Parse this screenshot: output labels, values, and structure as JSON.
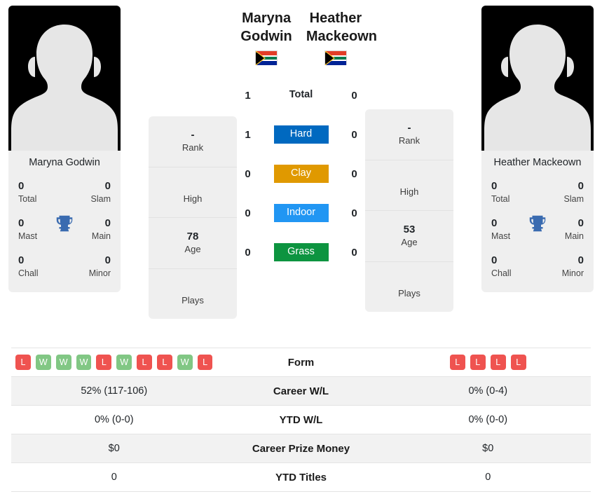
{
  "players": {
    "left": {
      "name": "Maryna Godwin",
      "card_name": "Maryna Godwin",
      "country": "South Africa",
      "flag_icon": "flag-south-africa",
      "photo_icon": "player-photo-placeholder",
      "rank": "-",
      "rank_label": "Rank",
      "high_value": "",
      "high_label": "High",
      "age": "78",
      "age_label": "Age",
      "plays_value": "",
      "plays_label": "Plays",
      "titles": {
        "total_value": "0",
        "total_label": "Total",
        "slam_value": "0",
        "slam_label": "Slam",
        "mast_value": "0",
        "mast_label": "Mast",
        "main_value": "0",
        "main_label": "Main",
        "chall_value": "0",
        "chall_label": "Chall",
        "minor_value": "0",
        "minor_label": "Minor",
        "trophy_icon": "trophy-icon"
      },
      "form": [
        "L",
        "W",
        "W",
        "W",
        "L",
        "W",
        "L",
        "L",
        "W",
        "L"
      ],
      "career_wl": "52% (117-106)",
      "ytd_wl": "0% (0-0)",
      "career_prize_money": "$0",
      "ytd_titles": "0"
    },
    "right": {
      "name": "Heather Mackeown",
      "card_name": "Heather Mackeown",
      "country": "South Africa",
      "flag_icon": "flag-south-africa",
      "photo_icon": "player-photo-placeholder",
      "rank": "-",
      "rank_label": "Rank",
      "high_value": "",
      "high_label": "High",
      "age": "53",
      "age_label": "Age",
      "plays_value": "",
      "plays_label": "Plays",
      "titles": {
        "total_value": "0",
        "total_label": "Total",
        "slam_value": "0",
        "slam_label": "Slam",
        "mast_value": "0",
        "mast_label": "Mast",
        "main_value": "0",
        "main_label": "Main",
        "chall_value": "0",
        "chall_label": "Chall",
        "minor_value": "0",
        "minor_label": "Minor",
        "trophy_icon": "trophy-icon"
      },
      "form": [
        "L",
        "L",
        "L",
        "L"
      ],
      "career_wl": "0% (0-4)",
      "ytd_wl": "0% (0-0)",
      "career_prize_money": "$0",
      "ytd_titles": "0"
    }
  },
  "head_to_head": [
    {
      "label": "Total",
      "left": "1",
      "right": "0",
      "color": ""
    },
    {
      "label": "Hard",
      "left": "1",
      "right": "0",
      "color": "#0069c0"
    },
    {
      "label": "Clay",
      "left": "0",
      "right": "0",
      "color": "#e09900"
    },
    {
      "label": "Indoor",
      "left": "0",
      "right": "0",
      "color": "#2196f3"
    },
    {
      "label": "Grass",
      "left": "0",
      "right": "0",
      "color": "#0d9440"
    }
  ],
  "stats_rows": [
    {
      "label": "Form",
      "left": "",
      "right": ""
    },
    {
      "label": "Career W/L",
      "left": "52% (117-106)",
      "right": "0% (0-4)"
    },
    {
      "label": "YTD W/L",
      "left": "0% (0-0)",
      "right": "0% (0-0)"
    },
    {
      "label": "Career Prize Money",
      "left": "$0",
      "right": "$0"
    },
    {
      "label": "YTD Titles",
      "left": "0",
      "right": "0"
    }
  ],
  "colors": {
    "win_badge": "#81c784",
    "loss_badge": "#ef5350",
    "trophy": "#3a6bb0",
    "card_bg": "#efefef",
    "row_shade": "#f2f2f2"
  }
}
